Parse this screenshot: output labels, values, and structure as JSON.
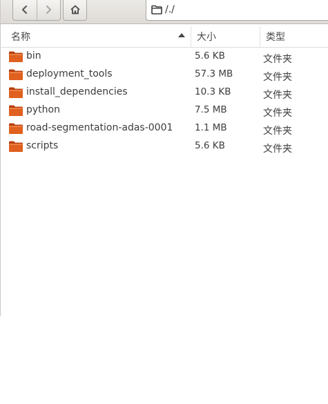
{
  "toolbar": {
    "back_icon": "chevron-left-icon",
    "forward_icon": "chevron-right-icon",
    "home_icon": "home-icon",
    "path": "/./"
  },
  "columns": {
    "name": "名称",
    "size": "大小",
    "type": "类型"
  },
  "files": [
    {
      "name": "bin",
      "size": "5.6 KB",
      "type": "文件夹"
    },
    {
      "name": "deployment_tools",
      "size": "57.3 MB",
      "type": "文件夹"
    },
    {
      "name": "install_dependencies",
      "size": "10.3 KB",
      "type": "文件夹"
    },
    {
      "name": "python",
      "size": "7.5 MB",
      "type": "文件夹"
    },
    {
      "name": "road-segmentation-adas-0001",
      "size": "1.1 MB",
      "type": "文件夹"
    },
    {
      "name": "scripts",
      "size": "5.6 KB",
      "type": "文件夹"
    }
  ],
  "colors": {
    "folder": "#e0601f",
    "folder_dark": "#b8400f"
  }
}
